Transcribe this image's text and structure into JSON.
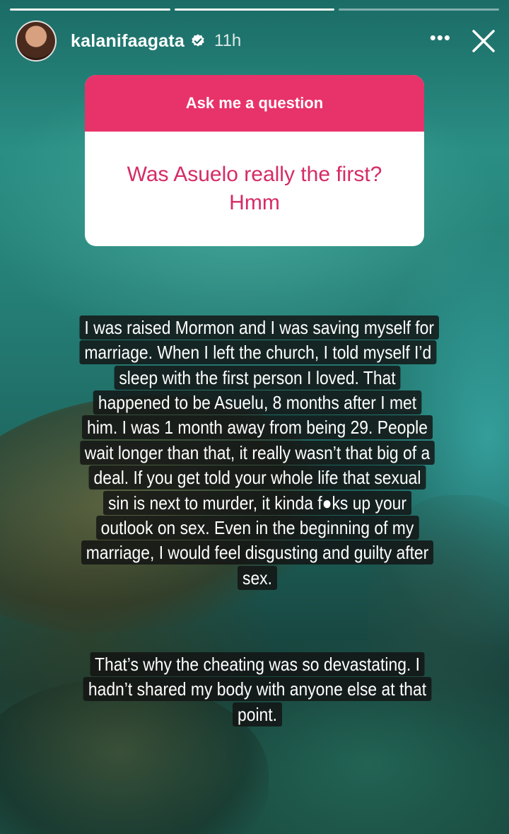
{
  "story": {
    "username": "kalanifaagata",
    "time_ago": "11h",
    "verified": true,
    "progress_segments": 3,
    "active_segment": 1,
    "more_label": "•••",
    "close_icon": "close-icon"
  },
  "question_sticker": {
    "prompt": "Ask me a question",
    "question": "Was Asuelo really the first? Hmm",
    "accent_color": "#e8326a"
  },
  "caption": {
    "paragraph1": "I was raised Mormon and I was saving myself for marriage. When I left the church, I told myself I’d sleep with the first person I loved. That happened to be Asuelu, 8 months after I met him. I was 1 month away from being 29. People wait longer than that, it really wasn’t that big of a deal. If you get told your whole life that sexual sin is next to murder, it kinda f●ks up your outlook on sex. Even in the beginning of my marriage, I would feel disgusting and guilty after sex.",
    "paragraph2": "That’s why the cheating was so devastating. I hadn’t shared my body with anyone else at that point."
  }
}
